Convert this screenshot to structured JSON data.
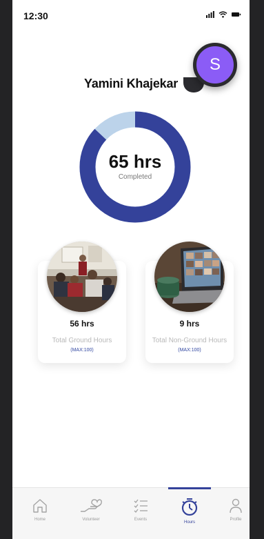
{
  "status_bar": {
    "time": "12:30"
  },
  "profile": {
    "name": "Yamini Khajekar",
    "avatar_initial": "S"
  },
  "hours": {
    "total_value": "65 hrs",
    "total_label": "Completed",
    "completed_fraction": 0.87
  },
  "cards": [
    {
      "value": "56 hrs",
      "label": "Total Ground Hours",
      "max": "(MAX:100)"
    },
    {
      "value": "9 hrs",
      "label": "Total Non-Ground Hours",
      "max": "(MAX:100)"
    }
  ],
  "tabs": [
    {
      "label": "Home",
      "icon": "home-icon",
      "active": false
    },
    {
      "label": "Volunteer",
      "icon": "volunteer-hand-icon",
      "active": false
    },
    {
      "label": "Events",
      "icon": "checklist-icon",
      "active": false
    },
    {
      "label": "Hours",
      "icon": "stopwatch-icon",
      "active": true
    },
    {
      "label": "Profile",
      "icon": "person-icon",
      "active": false
    }
  ],
  "colors": {
    "accent": "#34429a",
    "donut_remaining": "#bcd3ea",
    "avatar": "#8b5cf6"
  }
}
